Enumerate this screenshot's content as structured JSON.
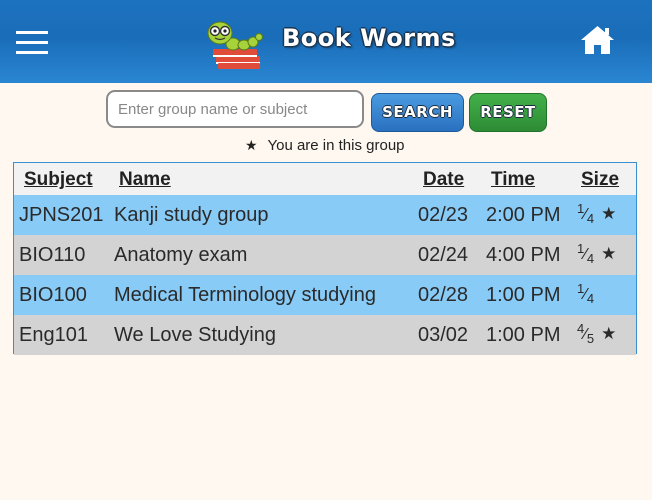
{
  "header": {
    "brand": "Book Worms"
  },
  "search": {
    "placeholder": "Enter group name or subject",
    "value": "",
    "search_label": "Search",
    "reset_label": "Reset"
  },
  "legend": {
    "star": "★",
    "text": "You are in this group"
  },
  "table": {
    "headers": {
      "subject": "Subject",
      "name": "Name",
      "date": "Date",
      "time": "Time",
      "size": "Size"
    },
    "rows": [
      {
        "subject": "JPNS201",
        "name": "Kanji study group",
        "date": "02/23",
        "time": "2:00 PM",
        "size_num": "1",
        "size_den": "4",
        "member": "★"
      },
      {
        "subject": "BIO110",
        "name": "Anatomy exam",
        "date": "02/24",
        "time": "4:00 PM",
        "size_num": "1",
        "size_den": "4",
        "member": "★"
      },
      {
        "subject": "BIO100",
        "name": "Medical Terminology studying",
        "date": "02/28",
        "time": "1:00 PM",
        "size_num": "1",
        "size_den": "4",
        "member": ""
      },
      {
        "subject": "Eng101",
        "name": "We Love Studying",
        "date": "03/02",
        "time": "1:00 PM",
        "size_num": "4",
        "size_den": "5",
        "member": "★"
      }
    ]
  },
  "colors": {
    "header": "#1d72bf",
    "row_blue": "#88cbf7",
    "row_gray": "#d3d3d3",
    "search_btn": "#2a70c0",
    "reset_btn": "#2d8c35",
    "background": "#fff8f0"
  }
}
